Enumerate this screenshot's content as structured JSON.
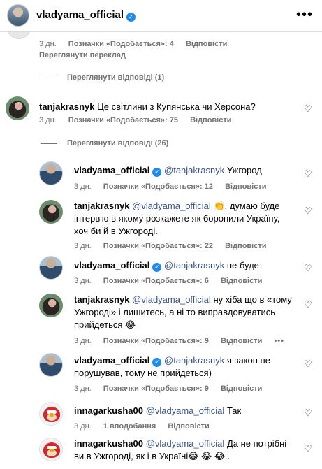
{
  "header": {
    "username": "vladyama_official",
    "more_label": "•••"
  },
  "top_meta": {
    "time": "3 дн.",
    "likes": "Позначки «Подобається»: 4",
    "reply": "Відповісти",
    "translate": "Переглянути переклад"
  },
  "view_replies_1": "Переглянути відповіді (1)",
  "comment_main": {
    "user": "tanjakrasnyk",
    "text": "Це світлини з Купянська чи Херсона?",
    "time": "3 дн.",
    "likes": "Позначки «Подобається»: 75",
    "reply": "Відповісти"
  },
  "view_replies_2": "Переглянути відповіді (26)",
  "replies": [
    {
      "user": "vladyama_official",
      "mention": "@tanjakrasnyk",
      "text_lines": [
        "Ужгород"
      ],
      "time": "3 дн.",
      "likes": "Позначки «Подобається»: 12",
      "reply": "Відповісти"
    },
    {
      "user": "tanjakrasnyk",
      "mention": "@vladyama_official",
      "text_lines": [
        "👏, думаю буде",
        "інтерв'ю в якому розкажете як боронили Україну,",
        "хоч би й в Ужгороді."
      ],
      "time": "3 дн.",
      "likes": "Позначки «Подобається»: 22",
      "reply": "Відповісти"
    },
    {
      "user": "vladyama_official",
      "mention": "@tanjakrasnyk",
      "text_lines": [
        "не буде"
      ],
      "time": "3 дн.",
      "likes": "Позначки «Подобається»: 6",
      "reply": "Відповісти"
    },
    {
      "user": "tanjakrasnyk",
      "mention": "@vladyama_official",
      "text_lines": [
        "ну хіба що в «тому",
        "Ужгороді» і лишитесь, а ні то виправдовуватись",
        "прийдеться 😂"
      ],
      "time": "3 дн.",
      "likes": "Позначки «Подобається»: 9",
      "reply": "Відповісти",
      "options": "•••"
    },
    {
      "user": "vladyama_official",
      "mention": "@tanjakrasnyk",
      "text_lines": [
        "я закон не",
        "порушував, тому не прийдеться)"
      ],
      "time": "3 дн.",
      "likes": "Позначки «Подобається»: 9",
      "reply": "Відповісти"
    },
    {
      "user": "innagarkusha00",
      "mention": "@vladyama_official",
      "text_lines": [
        "Так"
      ],
      "time": "3 дн.",
      "likes": "1 вподобання",
      "reply": "Відповісти"
    },
    {
      "user": "innagarkusha00",
      "mention": "@vladyama_official",
      "text_lines": [
        "Да не потрібні",
        "ви в Ужгороді, як і в Україні😂 😂 😂 ."
      ],
      "time": "",
      "likes": "",
      "reply": ""
    }
  ]
}
